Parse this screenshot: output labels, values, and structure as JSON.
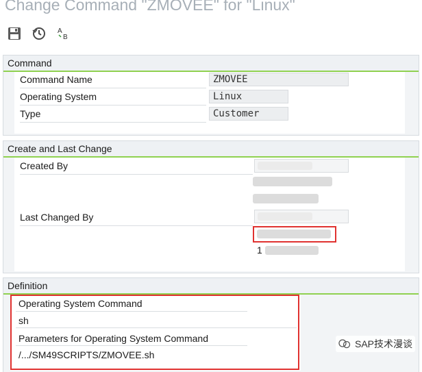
{
  "window": {
    "title": "Change Command \"ZMOVEE\" for \"Linux\""
  },
  "toolbar": {
    "buttons": [
      {
        "name": "save",
        "icon": "save-icon"
      },
      {
        "name": "check",
        "icon": "check-clock-icon"
      },
      {
        "name": "spelling",
        "icon": "ab-text-icon"
      }
    ]
  },
  "command": {
    "header": "Command",
    "name_label": "Command Name",
    "name_value": "ZMOVEE",
    "os_label": "Operating System",
    "os_value": "Linux",
    "type_label": "Type",
    "type_value": "Customer"
  },
  "create_change": {
    "header": "Create and Last Change",
    "created_by_label": "Created By",
    "last_changed_label": "Last Changed By",
    "last_changed_value_partial": "1"
  },
  "definition": {
    "header": "Definition",
    "os_command_label": "Operating System Command",
    "os_command_value": "sh",
    "params_label": "Parameters for Operating System Command",
    "params_value": "/.../SM49SCRIPTS/ZMOVEE.sh"
  },
  "watermark": {
    "text": "SAP技术漫谈"
  },
  "colors": {
    "accent_green": "#8fd14f",
    "highlight_red": "#e0312f",
    "title_grey": "#a7afb7"
  }
}
